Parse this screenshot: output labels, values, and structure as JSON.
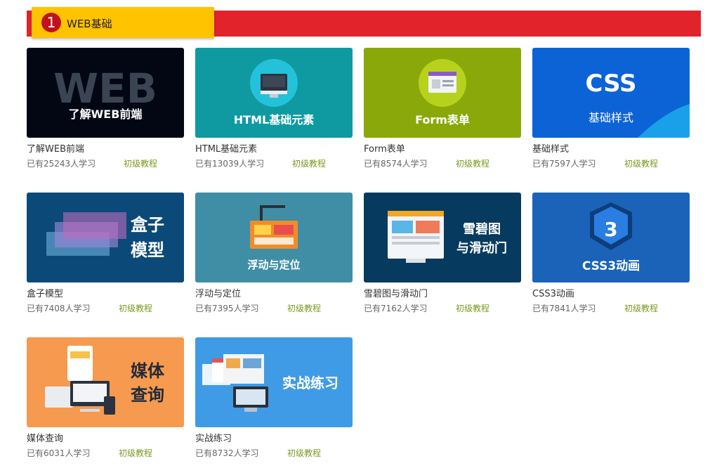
{
  "section": {
    "number": "1",
    "title": "WEB基础"
  },
  "courses": [
    {
      "title": "了解WEB前端",
      "learners": "已有25243人学习",
      "level": "初级教程",
      "thumb_text": "了解WEB前端",
      "thumb_big": "WEB"
    },
    {
      "title": "HTML基础元素",
      "learners": "已有13039人学习",
      "level": "初级教程",
      "thumb_text": "HTML基础元素"
    },
    {
      "title": "Form表单",
      "learners": "已有8574人学习",
      "level": "初级教程",
      "thumb_text": "Form表单"
    },
    {
      "title": "基础样式",
      "learners": "已有7597人学习",
      "level": "初级教程",
      "thumb_text": "基础样式",
      "thumb_big": "CSS"
    },
    {
      "title": "盒子模型",
      "learners": "已有7408人学习",
      "level": "初级教程",
      "thumb_line1": "盒子",
      "thumb_line2": "模型"
    },
    {
      "title": "浮动与定位",
      "learners": "已有7395人学习",
      "level": "初级教程",
      "thumb_text": "浮动与定位"
    },
    {
      "title": "雪碧图与滑动门",
      "learners": "已有7162人学习",
      "level": "初级教程",
      "thumb_line1": "雪碧图",
      "thumb_line2": "与滑动门"
    },
    {
      "title": "CSS3动画",
      "learners": "已有7841人学习",
      "level": "初级教程",
      "thumb_text": "CSS3动画"
    },
    {
      "title": "媒体查询",
      "learners": "已有6031人学习",
      "level": "初级教程",
      "thumb_line1": "媒体",
      "thumb_line2": "查询"
    },
    {
      "title": "实战练习",
      "learners": "已有8732人学习",
      "level": "初级教程",
      "thumb_text": "实战练习"
    }
  ],
  "colors": {
    "section_bar": "#e3232c",
    "section_tab": "#ffc300",
    "level_text": "#7a9a23"
  },
  "icons": [
    "web-wordcloud-icon",
    "monitor-icon",
    "form-window-icon",
    "css-logo-icon",
    "box-layers-icon",
    "construction-icon",
    "sprite-design-icon",
    "css3-shield-icon",
    "responsive-devices-icon",
    "website-stack-icon"
  ]
}
